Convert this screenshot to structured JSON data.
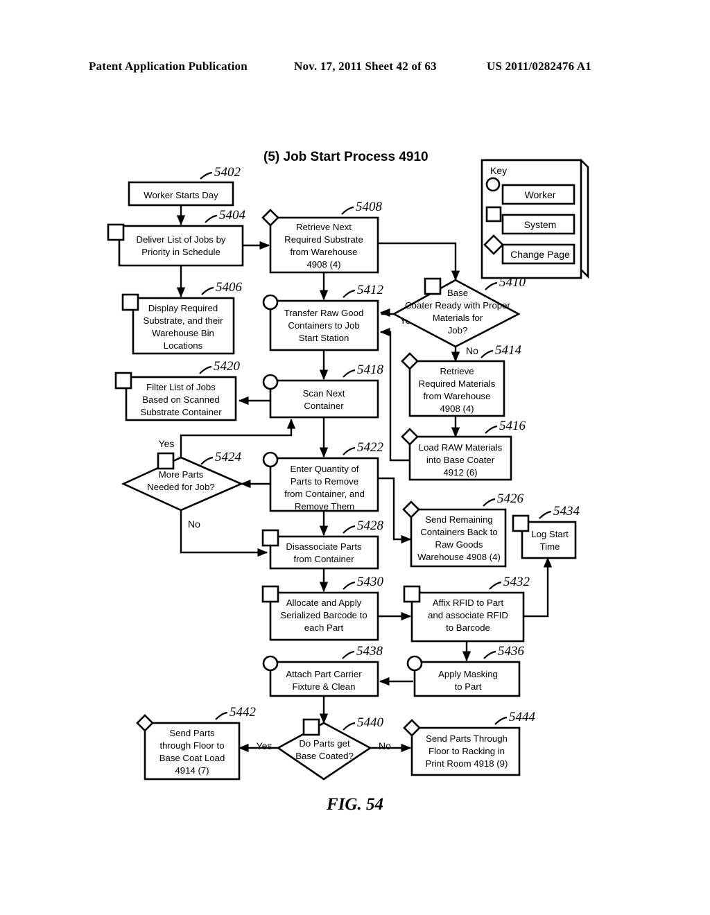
{
  "header": {
    "left": "Patent Application Publication",
    "middle": "Nov. 17, 2011  Sheet 42 of 63",
    "right": "US 2011/0282476 A1"
  },
  "figure": {
    "title": "(5) Job Start Process 4910",
    "caption": "FIG. 54"
  },
  "key": {
    "title": "Key",
    "items": [
      {
        "shape": "circle-badge",
        "label": "Worker"
      },
      {
        "shape": "square-badge",
        "label": "System"
      },
      {
        "shape": "diamond-badge",
        "label": "Change Page"
      }
    ]
  },
  "chart_data": {
    "type": "diagram",
    "title": "(5) Job Start Process 4910",
    "nodes": [
      {
        "ref": "5402",
        "type": "process",
        "badge": "none",
        "text": [
          "Worker Starts Day"
        ]
      },
      {
        "ref": "5404",
        "type": "process",
        "badge": "square",
        "text": [
          "Deliver List of Jobs by",
          "Priority in Schedule"
        ]
      },
      {
        "ref": "5406",
        "type": "process",
        "badge": "square",
        "text": [
          "Display Required",
          "Substrate, and their",
          "Warehouse Bin",
          "Locations"
        ]
      },
      {
        "ref": "5408",
        "type": "process",
        "badge": "diamond",
        "text": [
          "Retrieve Next",
          "Required Substrate",
          "from Warehouse",
          "4908 (4)"
        ]
      },
      {
        "ref": "5410",
        "type": "decision",
        "badge": "square",
        "text": [
          "Base",
          "Coater Ready with Proper",
          "Materials for",
          "Job?"
        ]
      },
      {
        "ref": "5412",
        "type": "process",
        "badge": "circle",
        "text": [
          "Transfer Raw Good",
          "Containers to Job",
          "Start Station"
        ]
      },
      {
        "ref": "5414",
        "type": "process",
        "badge": "diamond",
        "text": [
          "Retrieve",
          "Required Materials",
          "from Warehouse",
          "4908 (4)"
        ]
      },
      {
        "ref": "5416",
        "type": "process",
        "badge": "diamond",
        "text": [
          "Load RAW Materials",
          "into Base Coater",
          "4912 (6)"
        ]
      },
      {
        "ref": "5418",
        "type": "process",
        "badge": "circle",
        "text": [
          "Scan Next",
          "Container"
        ]
      },
      {
        "ref": "5420",
        "type": "process",
        "badge": "square",
        "text": [
          "Filter List of Jobs",
          "Based on Scanned",
          "Substrate Container"
        ]
      },
      {
        "ref": "5422",
        "type": "process",
        "badge": "circle",
        "text": [
          "Enter Quantity of",
          "Parts to Remove",
          "from Container, and",
          "Remove Them"
        ]
      },
      {
        "ref": "5424",
        "type": "decision",
        "badge": "square",
        "text": [
          "More Parts",
          "Needed for Job?"
        ]
      },
      {
        "ref": "5426",
        "type": "process",
        "badge": "diamond",
        "text": [
          "Send Remaining",
          "Containers Back to",
          "Raw Goods",
          "Warehouse 4908 (4)"
        ]
      },
      {
        "ref": "5428",
        "type": "process",
        "badge": "square",
        "text": [
          "Disassociate Parts",
          "from Container"
        ]
      },
      {
        "ref": "5430",
        "type": "process",
        "badge": "square",
        "text": [
          "Allocate and Apply",
          "Serialized Barcode to",
          "each Part"
        ]
      },
      {
        "ref": "5432",
        "type": "process",
        "badge": "square",
        "text": [
          "Affix RFID to Part",
          "and associate RFID",
          "to Barcode"
        ]
      },
      {
        "ref": "5434",
        "type": "process",
        "badge": "square",
        "text": [
          "Log Start",
          "Time"
        ]
      },
      {
        "ref": "5436",
        "type": "process",
        "badge": "circle",
        "text": [
          "Apply Masking",
          "to Part"
        ]
      },
      {
        "ref": "5438",
        "type": "process",
        "badge": "circle",
        "text": [
          "Attach Part Carrier",
          "Fixture & Clean"
        ]
      },
      {
        "ref": "5440",
        "type": "decision",
        "badge": "square",
        "text": [
          "Do Parts get",
          "Base Coated?"
        ]
      },
      {
        "ref": "5442",
        "type": "process",
        "badge": "diamond",
        "text": [
          "Send Parts",
          "through Floor to",
          "Base Coat Load",
          "4914 (7)"
        ]
      },
      {
        "ref": "5444",
        "type": "process",
        "badge": "diamond",
        "text": [
          "Send Parts Through",
          "Floor to Racking in",
          "Print Room 4918 (9)"
        ]
      }
    ],
    "edges": [
      {
        "from": "5402",
        "to": "5404",
        "label": ""
      },
      {
        "from": "5404",
        "to": "5406",
        "label": ""
      },
      {
        "from": "5404",
        "to": "5408",
        "label": ""
      },
      {
        "from": "5408",
        "to": "5412",
        "label": ""
      },
      {
        "from": "5408",
        "to": "5410",
        "label": ""
      },
      {
        "from": "5410",
        "to": "5412",
        "label": "Yes"
      },
      {
        "from": "5410",
        "to": "5414",
        "label": "No"
      },
      {
        "from": "5414",
        "to": "5416",
        "label": ""
      },
      {
        "from": "5416",
        "to": "5412",
        "label": ""
      },
      {
        "from": "5412",
        "to": "5418",
        "label": ""
      },
      {
        "from": "5418",
        "to": "5420",
        "label": ""
      },
      {
        "from": "5418",
        "to": "5422",
        "label": ""
      },
      {
        "from": "5422",
        "to": "5424",
        "label": ""
      },
      {
        "from": "5424",
        "to": "5418",
        "label": "Yes"
      },
      {
        "from": "5424",
        "to": "5428",
        "label": "No"
      },
      {
        "from": "5422",
        "to": "5426",
        "label": ""
      },
      {
        "from": "5422",
        "to": "5428",
        "label": ""
      },
      {
        "from": "5428",
        "to": "5430",
        "label": ""
      },
      {
        "from": "5430",
        "to": "5432",
        "label": ""
      },
      {
        "from": "5432",
        "to": "5434",
        "label": ""
      },
      {
        "from": "5432",
        "to": "5436",
        "label": ""
      },
      {
        "from": "5436",
        "to": "5438",
        "label": ""
      },
      {
        "from": "5438",
        "to": "5440",
        "label": ""
      },
      {
        "from": "5440",
        "to": "5442",
        "label": "Yes"
      },
      {
        "from": "5440",
        "to": "5444",
        "label": "No"
      }
    ]
  },
  "labels": {
    "yes_5410": "Yes",
    "no_5410": "No",
    "yes_5424": "Yes",
    "no_5424": "No",
    "yes_5440": "Yes",
    "no_5440": "No"
  },
  "refs": {
    "r5402": "5402",
    "r5404": "5404",
    "r5406": "5406",
    "r5408": "5408",
    "r5410": "5410",
    "r5412": "5412",
    "r5414": "5414",
    "r5416": "5416",
    "r5418": "5418",
    "r5420": "5420",
    "r5422": "5422",
    "r5424": "5424",
    "r5426": "5426",
    "r5428": "5428",
    "r5430": "5430",
    "r5432": "5432",
    "r5434": "5434",
    "r5436": "5436",
    "r5438": "5438",
    "r5440": "5440",
    "r5442": "5442",
    "r5444": "5444"
  },
  "text": {
    "t5402_0": "Worker Starts Day",
    "t5404_0": "Deliver List of Jobs by",
    "t5404_1": "Priority in Schedule",
    "t5406_0": "Display Required",
    "t5406_1": "Substrate, and their",
    "t5406_2": "Warehouse Bin",
    "t5406_3": "Locations",
    "t5408_0": "Retrieve Next",
    "t5408_1": "Required Substrate",
    "t5408_2": "from Warehouse",
    "t5408_3": "4908 (4)",
    "t5410_0": "Base",
    "t5410_1": "Coater Ready with Proper",
    "t5410_2": "Materials for",
    "t5410_3": "Job?",
    "t5412_0": "Transfer Raw Good",
    "t5412_1": "Containers to Job",
    "t5412_2": "Start Station",
    "t5414_0": "Retrieve",
    "t5414_1": "Required Materials",
    "t5414_2": "from Warehouse",
    "t5414_3": "4908 (4)",
    "t5416_0": "Load RAW Materials",
    "t5416_1": "into Base Coater",
    "t5416_2": "4912 (6)",
    "t5418_0": "Scan Next",
    "t5418_1": "Container",
    "t5420_0": "Filter List of Jobs",
    "t5420_1": "Based on Scanned",
    "t5420_2": "Substrate Container",
    "t5422_0": "Enter Quantity of",
    "t5422_1": "Parts to Remove",
    "t5422_2": "from Container, and",
    "t5422_3": "Remove Them",
    "t5424_0": "More Parts",
    "t5424_1": "Needed for Job?",
    "t5426_0": "Send Remaining",
    "t5426_1": "Containers Back to",
    "t5426_2": "Raw Goods",
    "t5426_3": "Warehouse 4908 (4)",
    "t5428_0": "Disassociate Parts",
    "t5428_1": "from Container",
    "t5430_0": "Allocate and Apply",
    "t5430_1": "Serialized Barcode to",
    "t5430_2": "each Part",
    "t5432_0": "Affix RFID to Part",
    "t5432_1": "and associate RFID",
    "t5432_2": "to Barcode",
    "t5434_0": "Log Start",
    "t5434_1": "Time",
    "t5436_0": "Apply Masking",
    "t5436_1": "to Part",
    "t5438_0": "Attach Part Carrier",
    "t5438_1": "Fixture & Clean",
    "t5440_0": "Do Parts get",
    "t5440_1": "Base Coated?",
    "t5442_0": "Send Parts",
    "t5442_1": "through Floor to",
    "t5442_2": "Base Coat Load",
    "t5442_3": "4914 (7)",
    "t5444_0": "Send Parts Through",
    "t5444_1": "Floor to Racking in",
    "t5444_2": "Print Room 4918 (9)",
    "key_worker": "Worker",
    "key_system": "System",
    "key_change": "Change Page"
  }
}
